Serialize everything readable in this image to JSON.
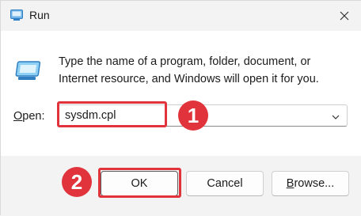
{
  "window": {
    "title": "Run",
    "description": "Type the name of a program, folder, document, or Internet resource, and Windows will open it for you."
  },
  "open": {
    "label_underlined": "O",
    "label_rest": "pen:",
    "value": "sysdm.cpl"
  },
  "buttons": {
    "ok": "OK",
    "cancel": "Cancel",
    "browse_underlined": "B",
    "browse_rest": "rowse..."
  },
  "annotations": {
    "step1": "1",
    "step2": "2",
    "color": "#e0333b"
  },
  "icons": {
    "title": "run-icon",
    "close": "close-icon",
    "dropdown": "chevron-down-icon",
    "body": "run-program-icon"
  }
}
